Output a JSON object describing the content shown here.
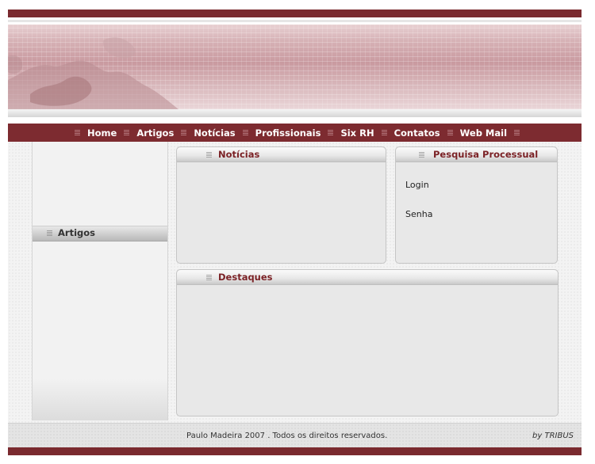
{
  "nav": {
    "items": [
      {
        "label": "Home"
      },
      {
        "label": "Artigos"
      },
      {
        "label": "Notícias"
      },
      {
        "label": "Profissionais"
      },
      {
        "label": "Six RH"
      },
      {
        "label": "Contatos"
      },
      {
        "label": "Web Mail"
      }
    ]
  },
  "sidebar": {
    "title": "Artigos"
  },
  "panels": {
    "news": {
      "title": "Notícias"
    },
    "search": {
      "title": "Pesquisa Processual",
      "login_label": "Login",
      "password_label": "Senha"
    },
    "highlights": {
      "title": "Destaques"
    }
  },
  "footer": {
    "copyright": "Paulo Madeira 2007 .  Todos os direitos reservados.",
    "credit": "by TRIBUS"
  },
  "colors": {
    "brand": "#7d2b30",
    "title_text": "#7b2226",
    "panel_bg": "#e8e8e8"
  },
  "icons": [
    "bullet-icon",
    "world-map-icon"
  ]
}
